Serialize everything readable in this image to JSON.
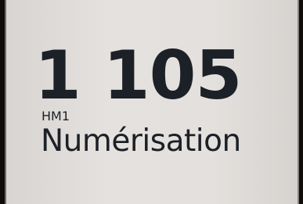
{
  "sign": {
    "room_number": "1 105",
    "room_code": "HM1",
    "room_name": "Numérisation"
  },
  "colors": {
    "sign_background": "#e4e0dd",
    "text": "#1c2027",
    "surround": "#0f0d0b"
  }
}
